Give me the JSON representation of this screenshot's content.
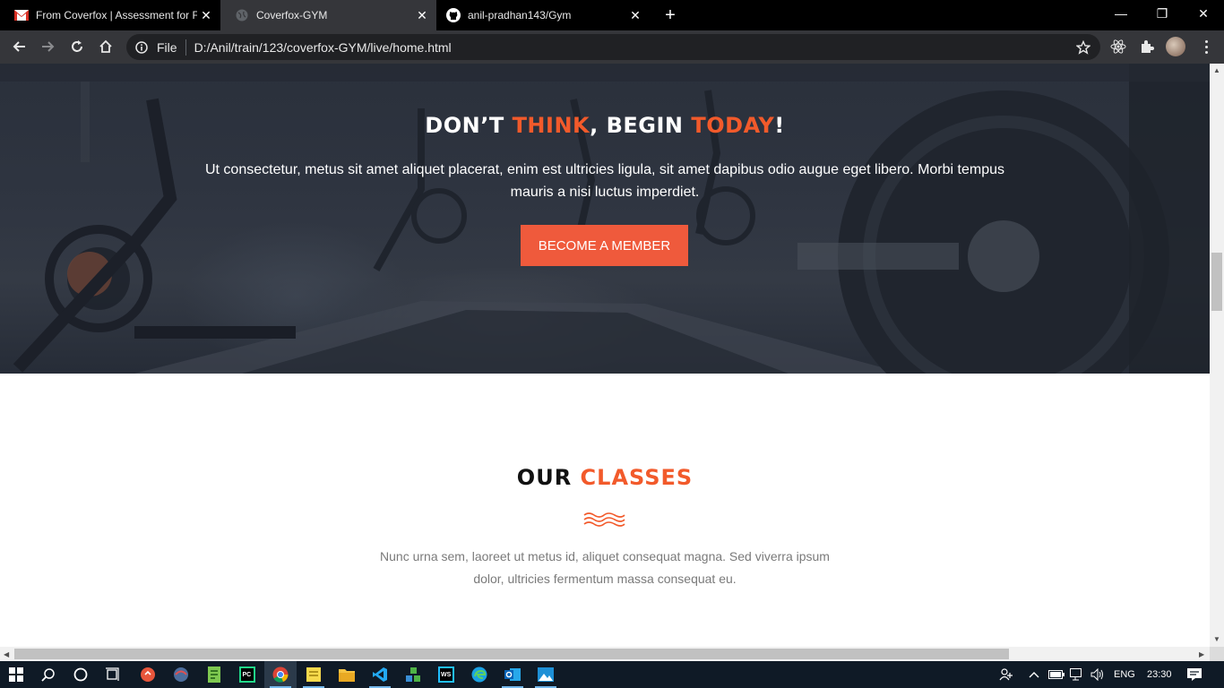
{
  "browser": {
    "tabs": [
      {
        "title": "From Coverfox | Assessment for F",
        "icon": "gmail-icon",
        "active": false
      },
      {
        "title": "Coverfox-GYM",
        "icon": "globe-icon",
        "active": true
      },
      {
        "title": "anil-pradhan143/Gym",
        "icon": "github-icon",
        "active": false
      }
    ],
    "new_tab": "+",
    "address": {
      "scheme": "File",
      "url": "D:/Anil/train/123/coverfox-GYM/live/home.html"
    }
  },
  "hero": {
    "title_part1": "DON’T ",
    "title_part2": "THINK",
    "title_part3": ", BEGIN ",
    "title_part4": "TODAY",
    "title_part5": "!",
    "text": "Ut consectetur, metus sit amet aliquet placerat, enim est ultricies ligula, sit amet dapibus odio augue eget libero. Morbi tempus mauris a nisi luctus imperdiet.",
    "cta_label": "BECOME A MEMBER"
  },
  "classes": {
    "title_part1": "OUR ",
    "title_part2": "CLASSES",
    "text": "Nunc urna sem, laoreet ut metus id, aliquet consequat magna. Sed viverra ipsum dolor, ultricies fermentum massa consequat eu."
  },
  "colors": {
    "accent": "#f25a2b",
    "button": "#ef5a3c",
    "hero_overlay": "#2f3541"
  },
  "taskbar": {
    "apps": [
      "windows-start-icon",
      "search-icon",
      "cortana-icon",
      "task-view-icon",
      "git-client-icon",
      "app-icon",
      "notepad-plus-icon",
      "pycharm-icon",
      "chrome-icon",
      "sticky-notes-icon",
      "file-explorer-icon",
      "vscode-icon",
      "network-app-icon",
      "webstorm-icon",
      "edge-icon",
      "outlook-icon",
      "photos-icon"
    ],
    "language": "ENG",
    "time": "23:30"
  }
}
